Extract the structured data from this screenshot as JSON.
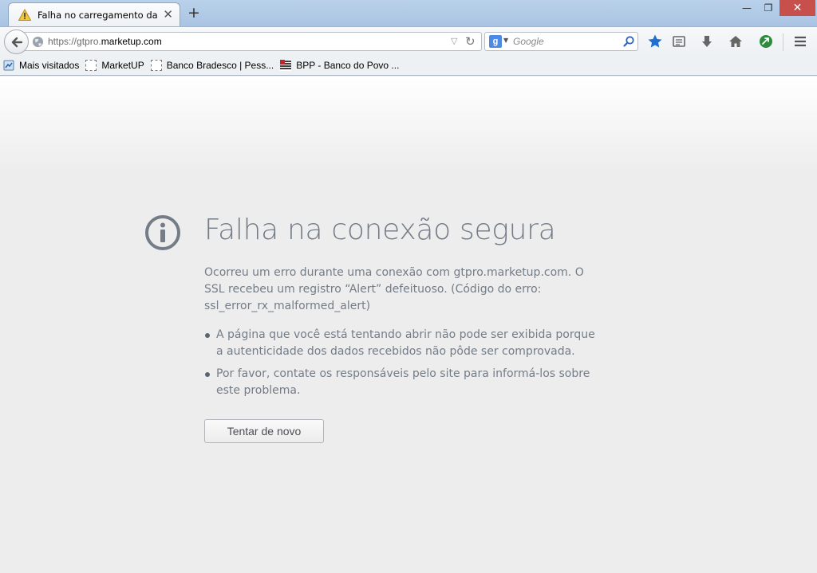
{
  "browser": {
    "tab": {
      "title": "Falha no carregamento da ...",
      "close": "✕"
    },
    "new_tab": "+",
    "window_controls": {
      "minimize": "—",
      "maximize": "❐",
      "close": "✕"
    },
    "url": {
      "prefix": "https://gtpro.",
      "domain": "marketup.com"
    },
    "search": {
      "placeholder": "Google",
      "engine": "g"
    },
    "bookmarks": [
      {
        "label": "Mais visitados",
        "icon": "most-visited-icon"
      },
      {
        "label": "MarketUP",
        "icon": "page-icon"
      },
      {
        "label": "Banco Bradesco | Pess...",
        "icon": "page-icon"
      },
      {
        "label": "BPP - Banco do Povo ...",
        "icon": "bpp-flag-icon"
      }
    ],
    "accent_color": "#1f6fd1"
  },
  "error": {
    "title": "Falha na conexão segura",
    "description": "Ocorreu um erro durante uma conexão com gtpro.marketup.com. O SSL recebeu um registro “Alert” defeituoso. (Código do erro: ssl_error_rx_malformed_alert)",
    "bullets": [
      "A página que você está tentando abrir não pode ser exibida porque a autenticidade dos dados recebidos não pôde ser comprovada.",
      "Por favor, contate os responsáveis pelo site para informá-los sobre este problema."
    ],
    "retry_label": "Tentar de novo",
    "text_color": "#737c87"
  }
}
